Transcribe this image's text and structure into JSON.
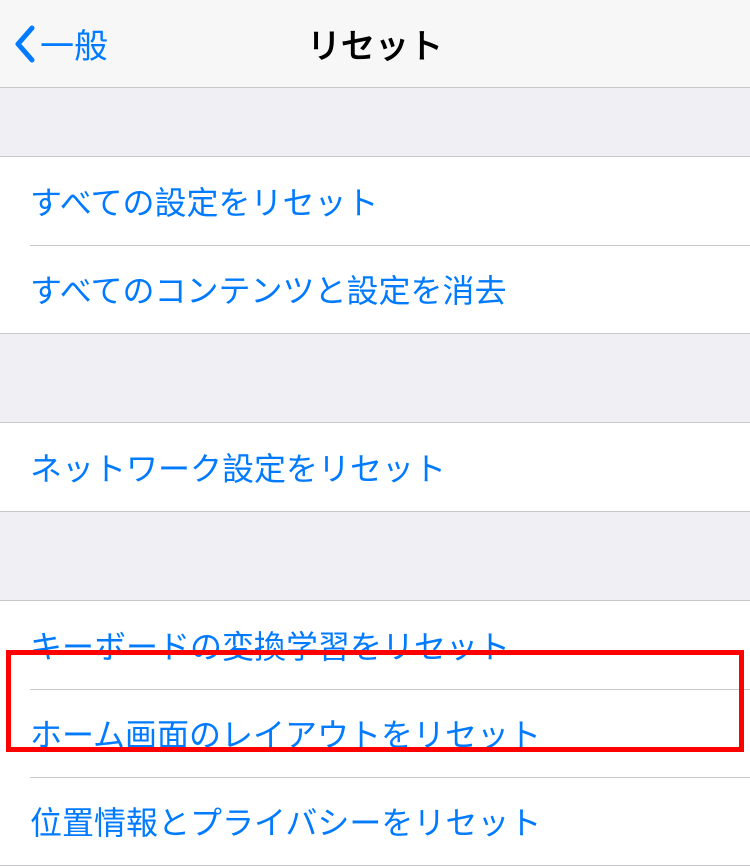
{
  "navbar": {
    "back_label": "一般",
    "title": "リセット"
  },
  "groups": [
    {
      "items": [
        {
          "label": "すべての設定をリセット",
          "name": "reset-all-settings"
        },
        {
          "label": "すべてのコンテンツと設定を消去",
          "name": "erase-all-content-settings"
        }
      ]
    },
    {
      "items": [
        {
          "label": "ネットワーク設定をリセット",
          "name": "reset-network-settings"
        }
      ]
    },
    {
      "items": [
        {
          "label": "キーボードの変換学習をリセット",
          "name": "reset-keyboard-dictionary"
        },
        {
          "label": "ホーム画面のレイアウトをリセット",
          "name": "reset-home-screen-layout"
        },
        {
          "label": "位置情報とプライバシーをリセット",
          "name": "reset-location-privacy"
        }
      ]
    }
  ]
}
